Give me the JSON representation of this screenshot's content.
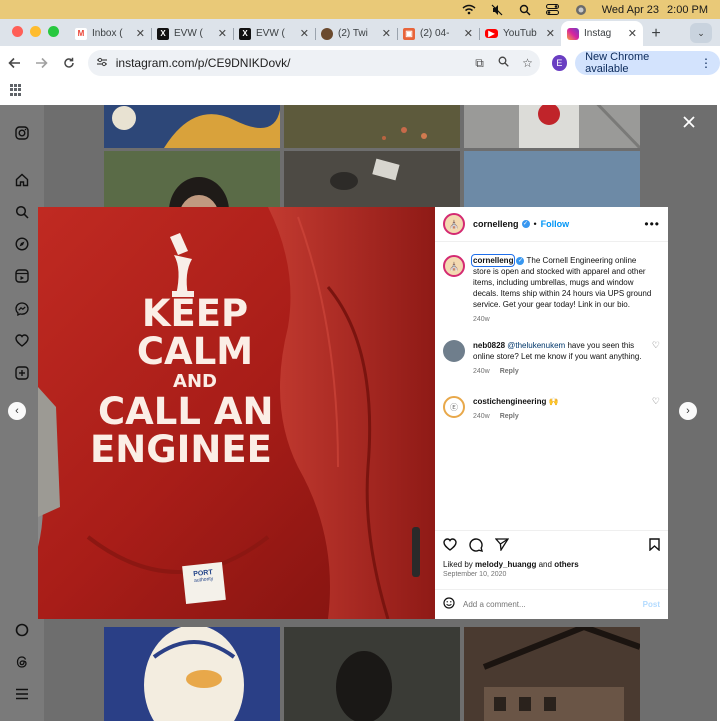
{
  "menubar": {
    "date": "Wed Apr 23",
    "time": "2:00 PM"
  },
  "tabs": [
    {
      "label": "Inbox (",
      "icon": "gmail-icon",
      "color": "#ea4335"
    },
    {
      "label": "EVW (",
      "icon": "x-icon",
      "color": "#111111"
    },
    {
      "label": "EVW (",
      "icon": "x-icon",
      "color": "#111111"
    },
    {
      "label": "(2) Twi",
      "icon": "twitch-avatar-icon",
      "color": "#6b4a2e"
    },
    {
      "label": "(2) 04-",
      "icon": "bookmark-icon",
      "color": "#e8643a"
    },
    {
      "label": "YouTub",
      "icon": "youtube-icon",
      "color": "#ff0000"
    },
    {
      "label": "Instag",
      "icon": "instagram-icon",
      "color": "#d6249f",
      "active": true
    }
  ],
  "address": {
    "url": "instagram.com/p/CE9DNIKDovk/"
  },
  "profile_initial": "E",
  "update_chip": {
    "label": "New Chrome available"
  },
  "poster": {
    "line1": "KEEP",
    "line2": "CALM",
    "line3": "AND",
    "line4": "CALL AN",
    "line5": "ENGINEE",
    "tag1": "PORT",
    "tag2": "authority"
  },
  "post": {
    "username": "cornelleng",
    "follow_label": "Follow",
    "caption_user": "cornelleng",
    "caption": "The Cornell Engineering online store is open and stocked with apparel and other items, including umbrellas, mugs and window decals. Items ship within 24 hours via UPS ground service. Get your gear today! Link in our bio.",
    "caption_age": "240w",
    "comments": [
      {
        "user": "neb0828",
        "mention": "@thelukenukem",
        "text": "have you seen this online store? Let me know if you want anything.",
        "age": "240w",
        "reply": "Reply"
      },
      {
        "user": "costichengineering",
        "text": "🙌",
        "age": "240w",
        "reply": "Reply"
      }
    ],
    "liked_by_prefix": "Liked by",
    "liked_by_user": "melody_huangg",
    "liked_by_and": "and",
    "liked_by_others": "others",
    "date": "September 10, 2020",
    "comment_placeholder": "Add a comment...",
    "post_label": "Post"
  }
}
